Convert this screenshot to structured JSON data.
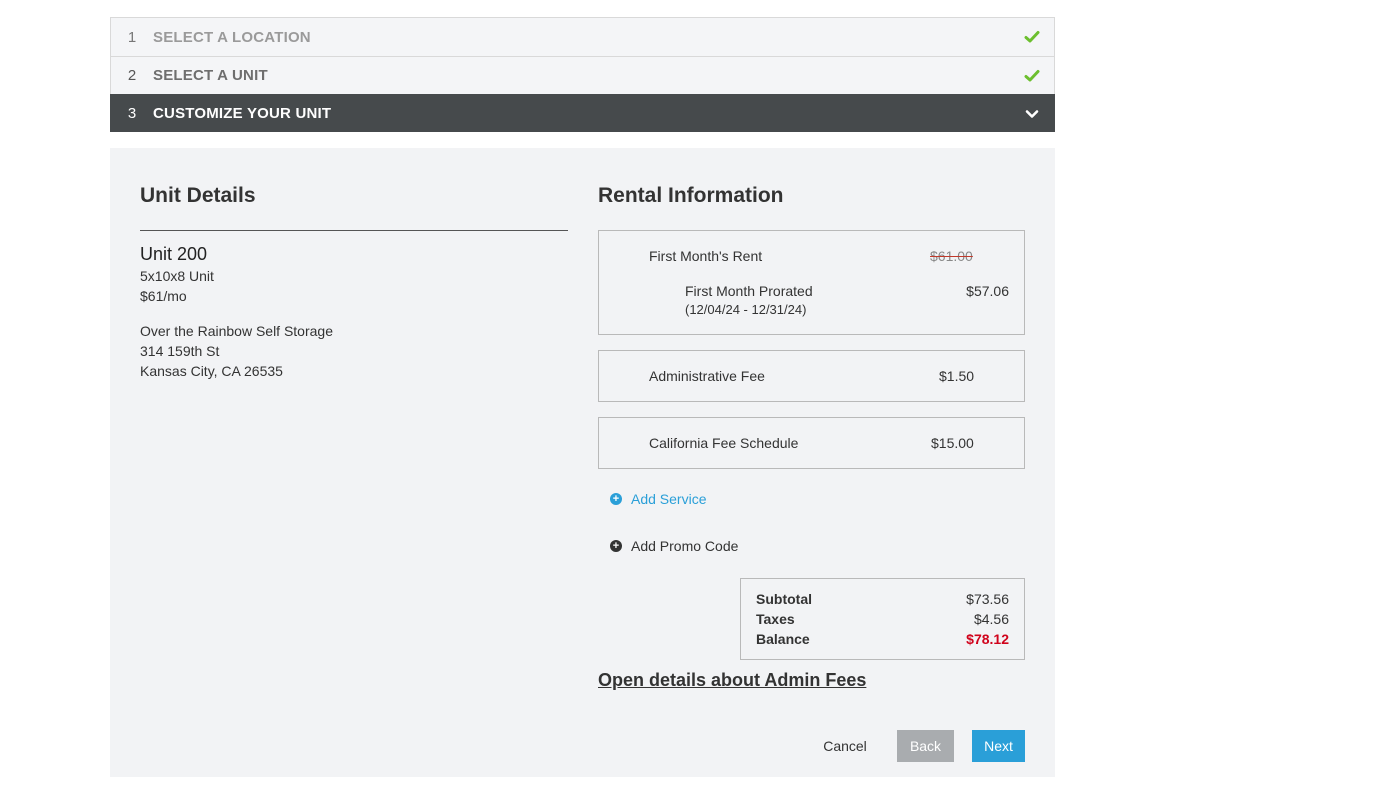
{
  "steps": [
    {
      "num": "1",
      "label": "SELECT A LOCATION"
    },
    {
      "num": "2",
      "label": "SELECT A UNIT"
    },
    {
      "num": "3",
      "label": "CUSTOMIZE YOUR UNIT"
    }
  ],
  "unit_details": {
    "title": "Unit Details",
    "unit_name": "Unit 200",
    "unit_size": "5x10x8 Unit",
    "unit_price": "$61/mo",
    "facility_name": "Over the Rainbow Self Storage",
    "address_line1": "314 159th St",
    "address_line2": "Kansas City, CA 26535"
  },
  "rental_info": {
    "title": "Rental Information",
    "first_month_label": "First Month's Rent",
    "first_month_original": "$61.00",
    "prorated_label": "First Month Prorated",
    "prorated_dates": "(12/04/24 - 12/31/24)",
    "prorated_value": "$57.06",
    "admin_fee_label": "Administrative Fee",
    "admin_fee_value": "$1.50",
    "ca_fee_label": "California Fee Schedule",
    "ca_fee_value": "$15.00",
    "add_service": "Add Service",
    "add_promo": "Add Promo Code",
    "subtotal_label": "Subtotal",
    "subtotal_value": "$73.56",
    "taxes_label": "Taxes",
    "taxes_value": "$4.56",
    "balance_label": "Balance",
    "balance_value": "$78.12",
    "admin_details_link": "Open details about Admin Fees"
  },
  "buttons": {
    "cancel": "Cancel",
    "back": "Back",
    "next": "Next"
  },
  "colors": {
    "accent": "#2a9fd8",
    "check": "#6cbf2f",
    "balance": "#d0021b",
    "active_step": "#464a4c"
  },
  "icons": {
    "step_done": "check-icon",
    "step_active": "chevron-down-icon",
    "add_service": "plus-circle-icon",
    "add_promo": "plus-circle-icon"
  }
}
